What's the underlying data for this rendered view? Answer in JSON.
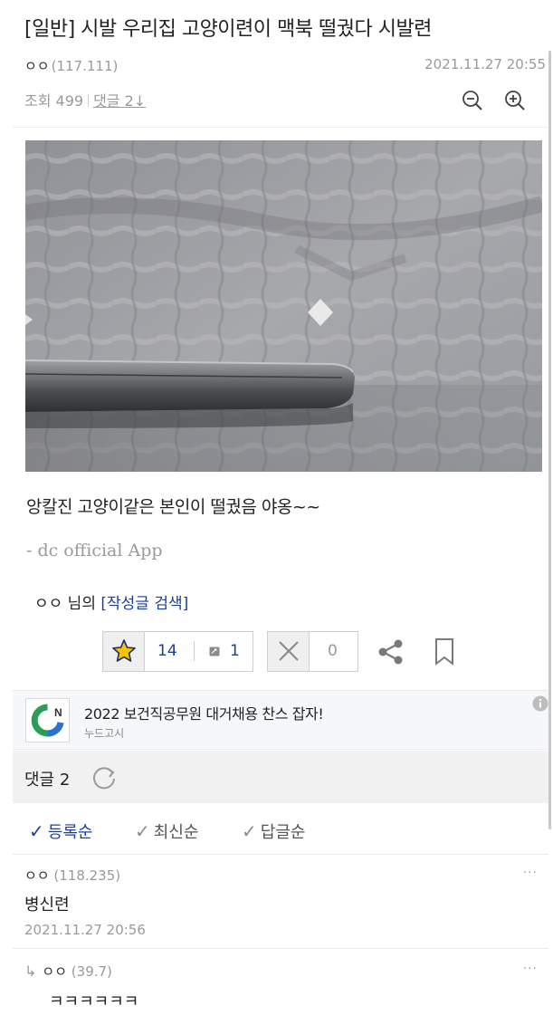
{
  "post": {
    "title": "[일반] 시발 우리집 고양이련이 맥북 떨궜다 시발련",
    "author": "ㅇㅇ",
    "author_ip": "(117.111)",
    "date": "2021.11.27 20:55",
    "views_label": "조회 499",
    "comments_link": "댓글 2↓",
    "body_text": "앙칼진 고양이같은 본인이 떨궜음 야옹~~",
    "app_signature": "- dc official App",
    "search_prefix": "ㅇㅇ 님의 ",
    "search_link": "[작성글 검색]"
  },
  "votes": {
    "up_count": "14",
    "fix_count": "1",
    "down_count": "0"
  },
  "ad": {
    "logo_letter": "N",
    "title": "2022 보건직공무원 대거채용 찬스 잡자!",
    "subtitle": "누드고시"
  },
  "comments_header": {
    "label": "댓글 2"
  },
  "sort": [
    {
      "label": "등록순",
      "active": true
    },
    {
      "label": "최신순",
      "active": false
    },
    {
      "label": "답글순",
      "active": false
    }
  ],
  "comments": [
    {
      "author": "ㅇㅇ",
      "ip": "(118.235)",
      "text": "병신련",
      "date": "2021.11.27 20:56",
      "more": "···"
    },
    {
      "reply_arrow": "↳",
      "author": "ㅇㅇ",
      "ip": "(39.7)",
      "text": "ㅋㅋㅋㅋㅋㅋ",
      "more": "···"
    }
  ],
  "colors": {
    "link_blue": "#1a3f9b",
    "muted_gray": "#9a9a9a",
    "star_yellow": "#f5c400",
    "ad_logo_green": "#2a9d58",
    "ad_logo_blue": "#2f6fd1"
  },
  "icons": [
    "zoom-out-icon",
    "zoom-in-icon",
    "star-icon",
    "fix-icon",
    "x-icon",
    "share-icon",
    "bookmark-icon",
    "info-icon",
    "refresh-icon",
    "check-icon"
  ]
}
